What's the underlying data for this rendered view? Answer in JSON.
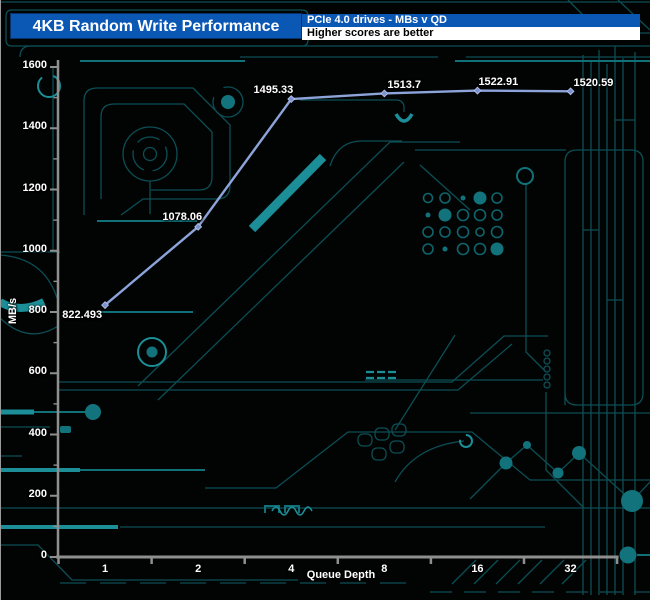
{
  "header": {
    "title": "4KB Random Write Performance",
    "subtitle": "PCIe 4.0 drives - MBs v QD",
    "note": "Higher scores are better"
  },
  "chart_data": {
    "type": "line",
    "categories": [
      "1",
      "2",
      "4",
      "8",
      "16",
      "32"
    ],
    "series": [
      {
        "values": [
          822.493,
          1078.06,
          1495.33,
          1513.7,
          1522.91,
          1520.59
        ]
      }
    ],
    "point_labels": [
      "822.493",
      "1078.06",
      "1495.33",
      "1513.7",
      "1522.91",
      "1520.59"
    ],
    "title": "4KB Random Write Performance",
    "xlabel": "Queue Depth",
    "ylabel": "MB/s",
    "ylim": [
      0,
      1600
    ],
    "y_tick_step": 200,
    "y_minor_tick_step": 100,
    "y_tick_labels": [
      "0",
      "200",
      "400",
      "600",
      "800",
      "1000",
      "1200",
      "1400",
      "1600"
    ],
    "grid": false,
    "legend": "none"
  },
  "colors": {
    "background": "#020404",
    "header_blue": "#0a57b4",
    "note_background": "#ffffff",
    "line": "#8da4da",
    "marker": "#7b93d0",
    "axis": "#8f8f8f",
    "circuit_teal": "#1b8e97",
    "label_text": "#ffffff"
  }
}
